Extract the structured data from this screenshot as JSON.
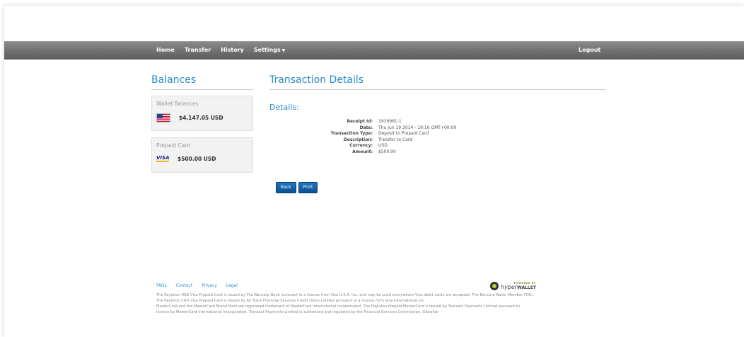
{
  "nav": {
    "items": [
      {
        "label": "Home"
      },
      {
        "label": "Transfer"
      },
      {
        "label": "History"
      },
      {
        "label": "Settings"
      }
    ],
    "logout": "Logout"
  },
  "sidebar": {
    "title": "Balances",
    "wallet": {
      "title": "Wallet Balances",
      "amount": "$4,147.05 USD",
      "icon": "us-flag-icon"
    },
    "prepaid": {
      "title": "Prepaid Card",
      "amount": "$500.00 USD",
      "icon": "visa-icon",
      "logo_text": "VISA"
    }
  },
  "main": {
    "title": "Transaction Details",
    "details_title": "Details:",
    "fields": [
      {
        "label": "Receipt Id:",
        "value": "1936981-1"
      },
      {
        "label": "Date:",
        "value": "Thu Jun 19 2014 - 19:16 GMT+00:00"
      },
      {
        "label": "Transaction Type:",
        "value": "Deposit to Prepaid Card"
      },
      {
        "label": "Description:",
        "value": "Transfer to Card"
      },
      {
        "label": "Currency:",
        "value": "USD"
      },
      {
        "label": "Amount:",
        "value": "$500.00"
      }
    ],
    "buttons": {
      "back": "Back",
      "print": "Print"
    }
  },
  "footer": {
    "links": [
      "FAQs",
      "Contact",
      "Privacy",
      "Legal"
    ],
    "powered": "POWERED BY",
    "brand_hyper": "hyper",
    "brand_wallet": "WALLET",
    "lines": [
      "The Payluton USD Visa Prepaid Card is issued by The Bancorp Bank pursuant to a license from Visa U.S.A. Inc. and may be used everywhere Visa debit cards are accepted. The Bancorp Bank; Member FDIC.",
      "The Payluton CAD Visa Prepaid Card is issued by All Trans Financial Services Credit Union Limited pursuant to a license from Visa International Inc.",
      "MasterCard and the MasterCard Brand Mark are registered trademark of MasterCard International Incorporated. The Payluton Prepaid MasterCard is issued by Transact Payments Limited pursuant to",
      "licence by MasterCard International Incorporated. Transact Payments Limited is authorised and regulated by the Financial Services Commission, Gibraltar"
    ]
  },
  "colors": {
    "accent": "#2b8cc4",
    "nav": "#6f6f6f",
    "button": "#1560a8"
  }
}
